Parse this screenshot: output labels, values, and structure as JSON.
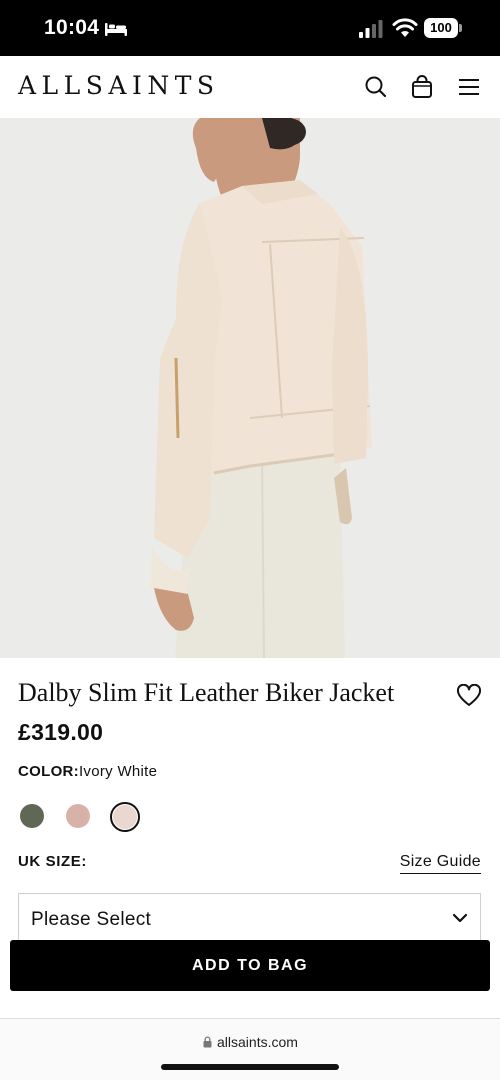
{
  "status_bar": {
    "time": "10:04",
    "battery": "100",
    "icons": [
      "bed-icon",
      "signal-icon",
      "wifi-icon",
      "battery-icon"
    ]
  },
  "header": {
    "brand": "ALLSAINTS",
    "icons": [
      "search-icon",
      "bag-icon",
      "menu-icon"
    ]
  },
  "product": {
    "title": "Dalby Slim Fit Leather Biker Jacket",
    "price": "£319.00",
    "color_label": "COLOR:",
    "color_value": "Ivory White",
    "swatches": [
      {
        "color": "#5f6755"
      },
      {
        "color": "#d8b2a8"
      },
      {
        "color": "#ead8d0",
        "selected": true
      }
    ],
    "size_label": "UK SIZE:",
    "size_guide": "Size Guide",
    "size_placeholder": "Please Select",
    "add_to_bag": "ADD TO BAG"
  },
  "browser": {
    "url": "allsaints.com"
  },
  "colors": {
    "background": "#ffffff",
    "status_bar": "#000000",
    "hero_background": "#ebebea",
    "button": "#000000",
    "button_text": "#ffffff"
  }
}
